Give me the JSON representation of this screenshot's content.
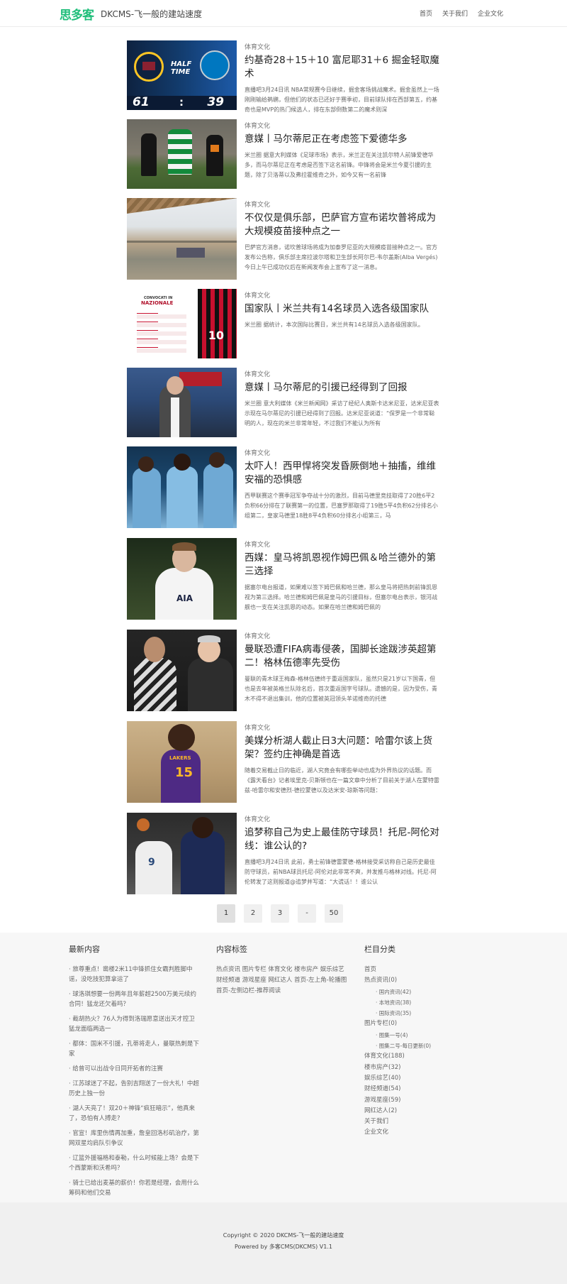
{
  "header": {
    "logo": "思多客",
    "site_title": "DKCMS-飞一般的建站速度",
    "nav": [
      "首页",
      "关于我们",
      "企业文化"
    ]
  },
  "articles": [
    {
      "category": "体育文化",
      "title": "约基奇28＋15＋10 富尼耶31＋6 掘金轻取魔术",
      "desc": "直播吧3月24日讯 NBA常规赛今日继续，掘金客场挑战魔术。掘金虽然上一场刚刚输给鹈鹕，但他们的状态已还好于赛季初，目前球队排在西部第五，约基奇也是MVP的热门候选人，排在东部倒数第二的魔术则深",
      "thumb": {
        "label1": "HALF",
        "label2": "TIME",
        "score_left": "61",
        "sep": ":",
        "score_right": "39"
      }
    },
    {
      "category": "体育文化",
      "title": "意媒丨马尔蒂尼正在考虑签下爱德华多",
      "desc": "米兰圈 据意大利媒体《足球市场》表示，米兰正在关注凯尔特人前锋爱德华多，而马尔蒂尼正在考虑是否签下这名前锋。中锋将会是米兰今夏引援的主题，除了贝洛蒂以及弗拉霍维奇之外，如今又有一名前锋"
    },
    {
      "category": "体育文化",
      "title": "不仅仅是俱乐部，巴萨官方宣布诺坎普将成为大规模疫苗接种点之一",
      "desc": "巴萨官方消息，诺坎普球场将成为加泰罗尼亚的大规模疫苗接种点之一。官方发布公告称，俱乐部主席拉波尔塔和卫生部长阿尔巴-韦尔盖斯(Alba Vergés)今日上午已成功仪后在新闻发布会上宣布了这一消息。"
    },
    {
      "category": "体育文化",
      "title": "国家队丨米兰共有14名球员入选各级国家队",
      "desc": "米兰圈 据统计，本次国际比赛日，米兰共有14名球员入选各级国家队。",
      "thumb": {
        "heading1": "CONVOCATI IN",
        "heading2": "NAZIONALE",
        "jersey": "10"
      }
    },
    {
      "category": "体育文化",
      "title": "意媒丨马尔蒂尼的引援已经得到了回报",
      "desc": "米兰圈 意大利媒体《米兰新闻网》采访了经纪人奥斯卡达米尼亚，达米尼亚表示现在马尔蒂尼的引援已经得到了回报。达米尼亚说道：“保罗是一个非常聪明的人，现在的米兰非常年轻，不过我们不能认为所有"
    },
    {
      "category": "体育文化",
      "title": "太吓人！西甲悍将突发昏厥倒地＋抽搐，维维安福的恐惧感",
      "desc": "西甲联赛这个赛季冠军争夺战十分的激烈，目前马德里竞技取得了20胜6平2负积66分排在了联赛第一的位置，巴塞罗那取得了19胜5平4负积62分排名小组第二，皇家马德里18胜8平4负积60分排名小组第三，马"
    },
    {
      "category": "体育文化",
      "title": "西媒：皇马将凯恩视作姆巴佩＆哈兰德外的第三选择",
      "desc": "据塞尔电台报道，如果难以签下姆巴佩和哈兰德，那么皇马将把热刺前锋凯恩视为第三选择。哈兰德和姆巴佩是皇马的引援目标，但塞尔电台表示，银河战舰也一支在关注凯恩的动态。如果在哈兰德和姆巴佩的"
    },
    {
      "category": "体育文化",
      "title": "曼联恐遭FIFA病毒侵袭，国脚长途跋涉英超第二！格林伍德率先受伤",
      "desc": "曼联的青木球王梅森-格林伍德终于重返国家队，虽然只是21岁以下国青，但也是去年被英格兰队除名后，首次重返国字号球队。遗憾的是，因为受伤，青木不得不退出集训，他的位置被英冠领头羊诺维奇的托德"
    },
    {
      "category": "体育文化",
      "title": "美媒分析湖人截止日3大问题：哈雷尔该上货架？签约庄神确是首选",
      "desc": "随着交易截止日的临近，湖人究竟会有哪些举动也成为外界热议的话题。而《露天看台》记者埃里克-贝斯顿也在一篇文章中分析了目前关于湖人在蒙特雷兹-哈雷尔和安德烈-德拉蒙德以及达米安-琼斯等问题："
    },
    {
      "category": "体育文化",
      "title": "追梦称自己为史上最佳防守球员！托尼-阿伦对线：谁公认的?",
      "desc": "直播吧3月24日讯 此前，勇士前锋德雷蒙德-格林接受采访称自己是历史最佳防守球员，前NBA球员托尼-阿伦对此非常不爽，并发推与格林对线。托尼-阿伦转发了这则报道@追梦并写道：“大谎话！！谁公认"
    }
  ],
  "pager": [
    "1",
    "2",
    "3",
    "-",
    "50"
  ],
  "footer": {
    "latest_title": "最新内容",
    "latest": [
      "旅尊重点！凿楼2米11中锋抓住女霸判胜脚中谣，没吃技犯算拿运了",
      "球洛琪想要一份两年且年薪超2500万美元续约合同！猛龙还欠着吗？",
      "截胡热火？76人为得到洛瑞愿意送出天才控卫 猛龙面临两选一",
      "都体：国米不引援，孔蒂将走人，曼联热刺是下家",
      "给曾可以出战令日同开拓者的注赛",
      "江苏球迷了不起，告别吉翔送了一份大礼！中超历史上独一份",
      "湖人天亮了！双20＋神锋“疯狂暗示”，他真来了，恐怕有人搏走?",
      "官宣！库里伤情再加重，詹皇回洛杉矶治疗，第网双星均肩队引争议",
      "辽篮外援福格和泰勒，什么时候能上场？会是下个西蒙斯和沃希吗？",
      "骑士已给出麦基的薪价！你若是经理，会用什么筹码和他们交易"
    ],
    "tags_title": "内容标签",
    "tags": "热点资讯 图片专栏 体育文化 楼市房产 娱乐综艺 财经频道 游戏星座 网红达人 首页-左上角-轮播图 首页-左侧边栏-推荐阅读",
    "cats_title": "栏目分类",
    "cats": [
      {
        "label": "首页",
        "sub": false
      },
      {
        "label": "热点资讯(0)",
        "sub": false
      },
      {
        "label": "国内资讯(42)",
        "sub": true
      },
      {
        "label": "本地资讯(38)",
        "sub": true
      },
      {
        "label": "国际资讯(35)",
        "sub": true
      },
      {
        "label": "图片专栏(0)",
        "sub": false
      },
      {
        "label": "图集一号(4)",
        "sub": true
      },
      {
        "label": "图集二号-每日更新(0)",
        "sub": true
      },
      {
        "label": "体育文化(188)",
        "sub": false
      },
      {
        "label": "楼市房产(32)",
        "sub": false
      },
      {
        "label": "娱乐综艺(40)",
        "sub": false
      },
      {
        "label": "财经频道(54)",
        "sub": false
      },
      {
        "label": "游戏星座(59)",
        "sub": false
      },
      {
        "label": "网红达人(2)",
        "sub": false
      },
      {
        "label": "关于我们",
        "sub": false
      },
      {
        "label": "企业文化",
        "sub": false
      }
    ],
    "copyright": "Copyright © 2020 DKCMS-飞一般的建站速度",
    "powered": "Powered by 多客CMS(DKCMS) V1.1"
  },
  "colors": {
    "brand": "#1fbe7a",
    "footer_bg": "#f7f7f7"
  }
}
